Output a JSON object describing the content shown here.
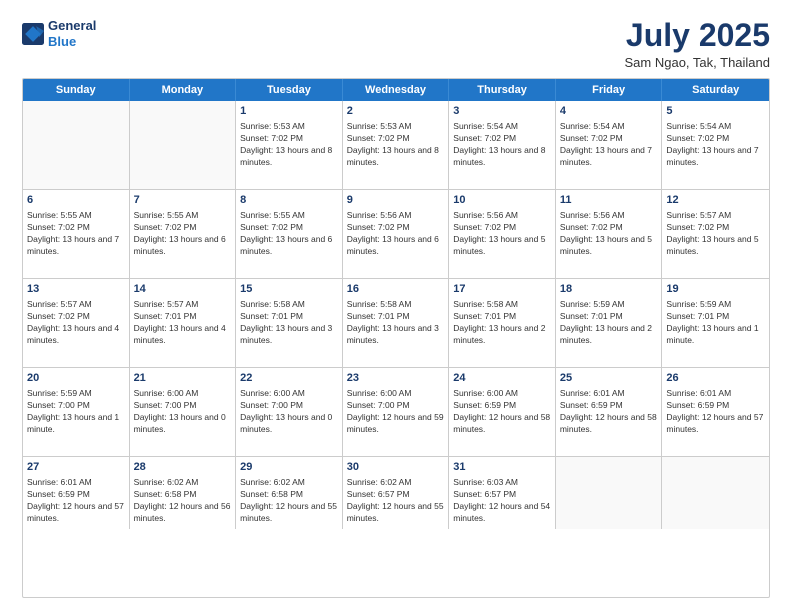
{
  "header": {
    "logo_line1": "General",
    "logo_line2": "Blue",
    "month": "July 2025",
    "location": "Sam Ngao, Tak, Thailand"
  },
  "days_of_week": [
    "Sunday",
    "Monday",
    "Tuesday",
    "Wednesday",
    "Thursday",
    "Friday",
    "Saturday"
  ],
  "weeks": [
    [
      {
        "day": "",
        "text": ""
      },
      {
        "day": "",
        "text": ""
      },
      {
        "day": "1",
        "text": "Sunrise: 5:53 AM\nSunset: 7:02 PM\nDaylight: 13 hours and 8 minutes."
      },
      {
        "day": "2",
        "text": "Sunrise: 5:53 AM\nSunset: 7:02 PM\nDaylight: 13 hours and 8 minutes."
      },
      {
        "day": "3",
        "text": "Sunrise: 5:54 AM\nSunset: 7:02 PM\nDaylight: 13 hours and 8 minutes."
      },
      {
        "day": "4",
        "text": "Sunrise: 5:54 AM\nSunset: 7:02 PM\nDaylight: 13 hours and 7 minutes."
      },
      {
        "day": "5",
        "text": "Sunrise: 5:54 AM\nSunset: 7:02 PM\nDaylight: 13 hours and 7 minutes."
      }
    ],
    [
      {
        "day": "6",
        "text": "Sunrise: 5:55 AM\nSunset: 7:02 PM\nDaylight: 13 hours and 7 minutes."
      },
      {
        "day": "7",
        "text": "Sunrise: 5:55 AM\nSunset: 7:02 PM\nDaylight: 13 hours and 6 minutes."
      },
      {
        "day": "8",
        "text": "Sunrise: 5:55 AM\nSunset: 7:02 PM\nDaylight: 13 hours and 6 minutes."
      },
      {
        "day": "9",
        "text": "Sunrise: 5:56 AM\nSunset: 7:02 PM\nDaylight: 13 hours and 6 minutes."
      },
      {
        "day": "10",
        "text": "Sunrise: 5:56 AM\nSunset: 7:02 PM\nDaylight: 13 hours and 5 minutes."
      },
      {
        "day": "11",
        "text": "Sunrise: 5:56 AM\nSunset: 7:02 PM\nDaylight: 13 hours and 5 minutes."
      },
      {
        "day": "12",
        "text": "Sunrise: 5:57 AM\nSunset: 7:02 PM\nDaylight: 13 hours and 5 minutes."
      }
    ],
    [
      {
        "day": "13",
        "text": "Sunrise: 5:57 AM\nSunset: 7:02 PM\nDaylight: 13 hours and 4 minutes."
      },
      {
        "day": "14",
        "text": "Sunrise: 5:57 AM\nSunset: 7:01 PM\nDaylight: 13 hours and 4 minutes."
      },
      {
        "day": "15",
        "text": "Sunrise: 5:58 AM\nSunset: 7:01 PM\nDaylight: 13 hours and 3 minutes."
      },
      {
        "day": "16",
        "text": "Sunrise: 5:58 AM\nSunset: 7:01 PM\nDaylight: 13 hours and 3 minutes."
      },
      {
        "day": "17",
        "text": "Sunrise: 5:58 AM\nSunset: 7:01 PM\nDaylight: 13 hours and 2 minutes."
      },
      {
        "day": "18",
        "text": "Sunrise: 5:59 AM\nSunset: 7:01 PM\nDaylight: 13 hours and 2 minutes."
      },
      {
        "day": "19",
        "text": "Sunrise: 5:59 AM\nSunset: 7:01 PM\nDaylight: 13 hours and 1 minute."
      }
    ],
    [
      {
        "day": "20",
        "text": "Sunrise: 5:59 AM\nSunset: 7:00 PM\nDaylight: 13 hours and 1 minute."
      },
      {
        "day": "21",
        "text": "Sunrise: 6:00 AM\nSunset: 7:00 PM\nDaylight: 13 hours and 0 minutes."
      },
      {
        "day": "22",
        "text": "Sunrise: 6:00 AM\nSunset: 7:00 PM\nDaylight: 13 hours and 0 minutes."
      },
      {
        "day": "23",
        "text": "Sunrise: 6:00 AM\nSunset: 7:00 PM\nDaylight: 12 hours and 59 minutes."
      },
      {
        "day": "24",
        "text": "Sunrise: 6:00 AM\nSunset: 6:59 PM\nDaylight: 12 hours and 58 minutes."
      },
      {
        "day": "25",
        "text": "Sunrise: 6:01 AM\nSunset: 6:59 PM\nDaylight: 12 hours and 58 minutes."
      },
      {
        "day": "26",
        "text": "Sunrise: 6:01 AM\nSunset: 6:59 PM\nDaylight: 12 hours and 57 minutes."
      }
    ],
    [
      {
        "day": "27",
        "text": "Sunrise: 6:01 AM\nSunset: 6:59 PM\nDaylight: 12 hours and 57 minutes."
      },
      {
        "day": "28",
        "text": "Sunrise: 6:02 AM\nSunset: 6:58 PM\nDaylight: 12 hours and 56 minutes."
      },
      {
        "day": "29",
        "text": "Sunrise: 6:02 AM\nSunset: 6:58 PM\nDaylight: 12 hours and 55 minutes."
      },
      {
        "day": "30",
        "text": "Sunrise: 6:02 AM\nSunset: 6:57 PM\nDaylight: 12 hours and 55 minutes."
      },
      {
        "day": "31",
        "text": "Sunrise: 6:03 AM\nSunset: 6:57 PM\nDaylight: 12 hours and 54 minutes."
      },
      {
        "day": "",
        "text": ""
      },
      {
        "day": "",
        "text": ""
      }
    ]
  ]
}
